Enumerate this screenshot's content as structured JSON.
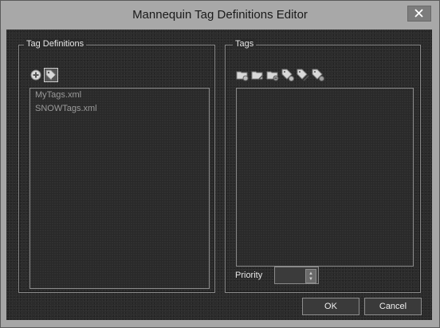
{
  "window": {
    "title": "Mannequin Tag Definitions Editor"
  },
  "left_panel": {
    "label": "Tag Definitions",
    "toolbar": [
      {
        "icon": "add-circle-icon"
      },
      {
        "icon": "tag-edit-icon"
      }
    ],
    "files": [
      "MyTags.xml",
      "SNOWTags.xml"
    ]
  },
  "right_panel": {
    "label": "Tags",
    "toolbar": [
      {
        "icon": "folder-add-icon"
      },
      {
        "icon": "folder-edit-icon"
      },
      {
        "icon": "folder-delete-icon"
      },
      {
        "icon": "tag-add-icon"
      },
      {
        "icon": "tag-edit-icon"
      },
      {
        "icon": "tag-delete-icon"
      }
    ],
    "priority_label": "Priority",
    "priority_value": ""
  },
  "buttons": {
    "ok": "OK",
    "cancel": "Cancel"
  },
  "colors": {
    "client_bg": "#2b2b2b",
    "titlebar_bg": "#a8a8a8",
    "text": "#e6e6e6",
    "list_text": "#9a9a9a"
  }
}
